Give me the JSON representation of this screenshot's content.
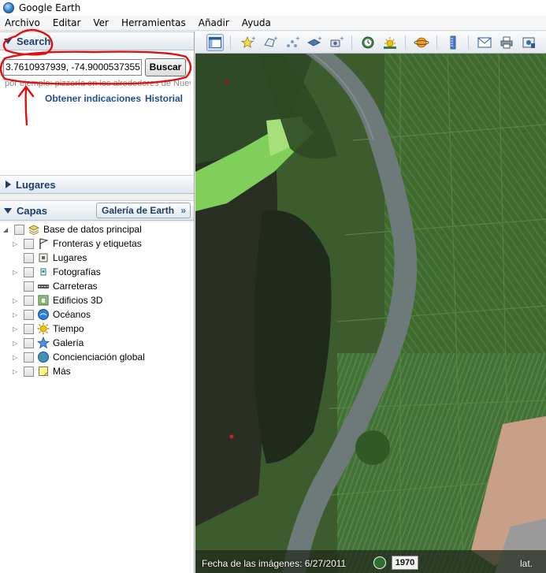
{
  "window": {
    "title": "Google Earth"
  },
  "menu": [
    "Archivo",
    "Editar",
    "Ver",
    "Herramientas",
    "Añadir",
    "Ayuda"
  ],
  "search": {
    "title": "Search",
    "value": "3.7610937939, -74.9000537355 ()",
    "button_label": "Buscar",
    "hint": "por ejemplo: pizzería en los alrededores de Nueva",
    "directions_link": "Obtener indicaciones",
    "history_link": "Historial"
  },
  "places": {
    "title": "Lugares"
  },
  "layers": {
    "title": "Capas",
    "gallery_button": "Galería de Earth",
    "gallery_chevron": "»",
    "root_label": "Base de datos principal",
    "items": [
      {
        "label": "Fronteras y etiquetas",
        "icon": "flag-icon",
        "expandable": true
      },
      {
        "label": "Lugares",
        "icon": "places-icon",
        "expandable": false
      },
      {
        "label": "Fotografías",
        "icon": "photo-icon",
        "expandable": true
      },
      {
        "label": "Carreteras",
        "icon": "road-icon",
        "expandable": false
      },
      {
        "label": "Edificios 3D",
        "icon": "building-icon",
        "expandable": true
      },
      {
        "label": "Océanos",
        "icon": "ocean-icon",
        "expandable": true
      },
      {
        "label": "Tiempo",
        "icon": "weather-icon",
        "expandable": true
      },
      {
        "label": "Galería",
        "icon": "gallery-star-icon",
        "expandable": true
      },
      {
        "label": "Concienciación global",
        "icon": "globe-icon",
        "expandable": true
      },
      {
        "label": "Más",
        "icon": "more-icon",
        "expandable": true
      }
    ]
  },
  "toolbar": {
    "buttons": [
      "sidebar-toggle-icon",
      "placemark-icon",
      "polygon-icon",
      "path-icon",
      "overlay-icon",
      "tour-icon",
      "historical-imagery-icon",
      "sunlight-icon",
      "planets-icon",
      "ruler-icon",
      "email-icon",
      "print-icon",
      "save-image-icon"
    ]
  },
  "status": {
    "imagery_date": "Fecha de las imágenes: 6/27/2011",
    "year": "1970",
    "lat_label": "lat."
  },
  "colors": {
    "annotation": "#e01010",
    "link": "#1f4f8f",
    "header_text": "#1e3e66"
  }
}
